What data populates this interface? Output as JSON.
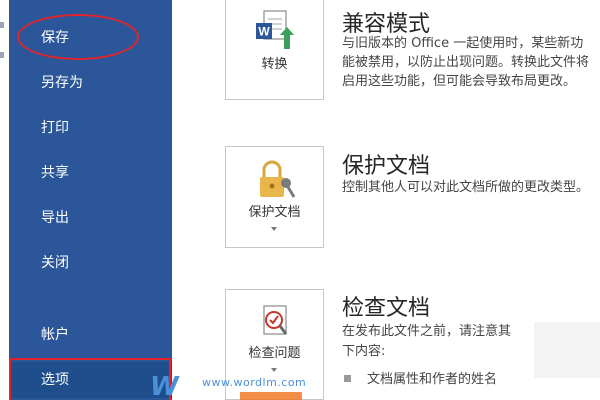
{
  "sidebar": {
    "items": [
      {
        "label": "保存"
      },
      {
        "label": "另存为"
      },
      {
        "label": "打印"
      },
      {
        "label": "共享"
      },
      {
        "label": "导出"
      },
      {
        "label": "关闭"
      },
      {
        "label": "帐户"
      },
      {
        "label": "选项"
      }
    ]
  },
  "sections": [
    {
      "button_label": "转换",
      "icon": "word-convert-icon",
      "title": "兼容模式",
      "description": "与旧版本的 Office 一起使用时，某些新功能被禁用，以防止出现问题。转换此文件将启用这些功能，但可能会导致布局更改。"
    },
    {
      "button_label": "保护文档",
      "icon": "lock-key-icon",
      "title": "保护文档",
      "description": "控制其他人可以对此文档所做的更改类型。"
    },
    {
      "button_label": "检查问题",
      "icon": "inspect-document-icon",
      "title": "检查文档",
      "description": "在发布此文件之前，请注意其",
      "description_2": "下内容:",
      "bullets": [
        "文档属性和作者的姓名"
      ]
    }
  ],
  "watermark": {
    "logo": "W",
    "url": "www.wordlm.com"
  },
  "colors": {
    "sidebar_bg": "#2b579a",
    "selected_bg": "#1e4e8c",
    "annotation": "#e0242a"
  }
}
